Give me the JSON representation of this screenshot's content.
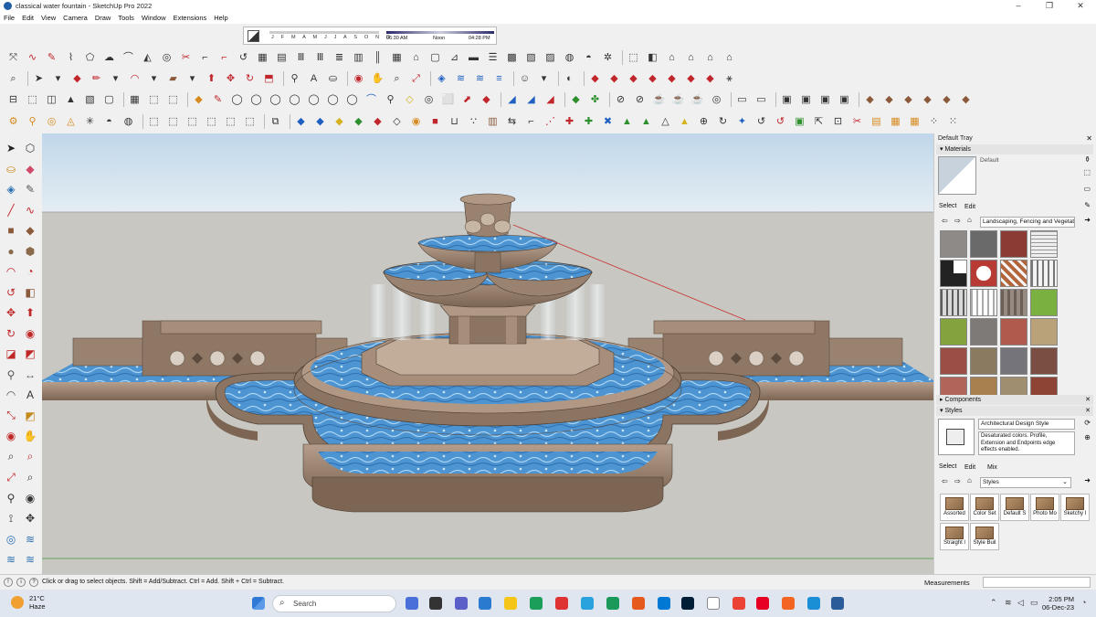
{
  "window": {
    "title": "classical water fountain - SketchUp Pro 2022",
    "controls": [
      "–",
      "❐",
      "✕"
    ]
  },
  "menu": [
    "File",
    "Edit",
    "View",
    "Camera",
    "Draw",
    "Tools",
    "Window",
    "Extensions",
    "Help"
  ],
  "shadow": {
    "months": "J F M A M J J A S O N D",
    "time_start": "06:30 AM",
    "time_mid": "Noon",
    "time_end": "04:28 PM"
  },
  "tray": {
    "title": "Default Tray",
    "materials": {
      "header": "Materials",
      "current": "Default",
      "tab_select": "Select",
      "tab_edit": "Edit",
      "library": "Landscaping, Fencing and Vegetation"
    },
    "components": {
      "header": "Components"
    },
    "styles": {
      "header": "Styles",
      "current_name": "Architectural Design Style",
      "description": "Desaturated colors. Profile, Extension and Endpoints edge effects enabled.",
      "tab_select": "Select",
      "tab_edit": "Edit",
      "tab_mix": "Mix",
      "library": "Styles",
      "items": [
        "Assorted",
        "Color Set",
        "Default S",
        "Photo Mo",
        "Sketchy I",
        "Straight l",
        "Style Buil"
      ]
    }
  },
  "status": {
    "message": "Click or drag to select objects. Shift = Add/Subtract. Ctrl = Add. Shift + Ctrl = Subtract.",
    "measurements_label": "Measurements"
  },
  "taskbar": {
    "temperature": "21°C",
    "weather": "Haze",
    "search": "Search",
    "time": "2:05 PM",
    "date": "06-Dec-23"
  },
  "colors": {
    "sky": "#cfe0ef",
    "ground": "#c9c8c2",
    "water": "#5e9ed6",
    "stone": "#a08672",
    "taskbar": "#dfe6ef"
  }
}
